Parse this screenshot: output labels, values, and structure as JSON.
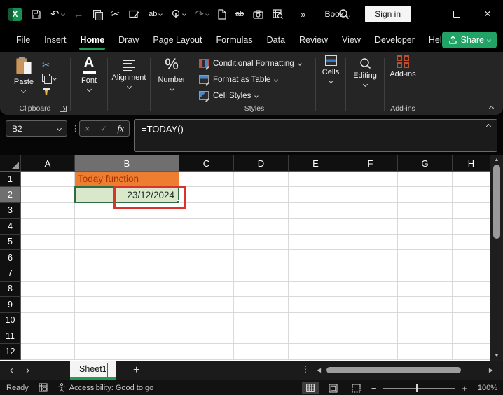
{
  "titlebar": {
    "app_logo_letter": "X",
    "document_title": "Book...",
    "sign_in_label": "Sign in"
  },
  "menubar": {
    "tabs": [
      "File",
      "Insert",
      "Home",
      "Draw",
      "Page Layout",
      "Formulas",
      "Data",
      "Review",
      "View",
      "Developer",
      "Help"
    ],
    "active_tab": "Home",
    "share_label": "Share"
  },
  "ribbon": {
    "clipboard": {
      "paste_label": "Paste",
      "group_label": "Clipboard"
    },
    "font": {
      "label": "Font"
    },
    "alignment": {
      "label": "Alignment"
    },
    "number": {
      "label": "Number",
      "icon_glyph": "%"
    },
    "styles": {
      "conditional_formatting_label": "Conditional Formatting",
      "format_as_table_label": "Format as Table",
      "cell_styles_label": "Cell Styles",
      "group_label": "Styles"
    },
    "cells": {
      "label": "Cells"
    },
    "editing": {
      "label": "Editing"
    },
    "addins": {
      "label": "Add-ins",
      "group_label": "Add-ins"
    }
  },
  "formula_bar": {
    "name_box_value": "B2",
    "fx_label": "fx",
    "formula": "=TODAY()"
  },
  "grid": {
    "columns": [
      "A",
      "B",
      "C",
      "D",
      "E",
      "F",
      "G",
      "H"
    ],
    "row_numbers": [
      1,
      2,
      3,
      4,
      5,
      6,
      7,
      8,
      9,
      10,
      11,
      12
    ],
    "selected_cell": "B2",
    "selected_column": "B",
    "selected_row": 2,
    "cells": {
      "B1": {
        "text": "Today function",
        "fill": "#ED7D31",
        "color": "#A83200",
        "align": "left"
      },
      "B2": {
        "text": "23/12/2024",
        "fill": "#D9E7CB",
        "color": "#1F3325",
        "align": "right"
      }
    }
  },
  "sheet_bar": {
    "tabs": [
      {
        "label": "Sheet1",
        "active": true
      }
    ]
  },
  "status_bar": {
    "mode": "Ready",
    "accessibility_text": "Accessibility: Good to go",
    "zoom_level": "100%"
  },
  "glyphs": {
    "undo": "↶",
    "redo": "↷",
    "back_arrow": "←",
    "scissors": "✂",
    "more_commands": "»",
    "dots_vertical": "⋮",
    "check": "✓",
    "cancel": "×",
    "close": "×",
    "minimize": "—",
    "ab": "ab",
    "plus": "+",
    "nav_left": "‹",
    "nav_right": "›",
    "tri_up": "▲",
    "tri_down": "▼",
    "tri_left": "◀",
    "tri_right": "▶",
    "zoom_out": "−",
    "zoom_in": "+",
    "font_letter": "A"
  },
  "colors": {
    "accent_green": "#21A366",
    "selection_green": "#2F6C43",
    "annotation_red": "#D8342C",
    "header_orange": "#ED7D31",
    "cell_green_fill": "#D9E7CB"
  }
}
